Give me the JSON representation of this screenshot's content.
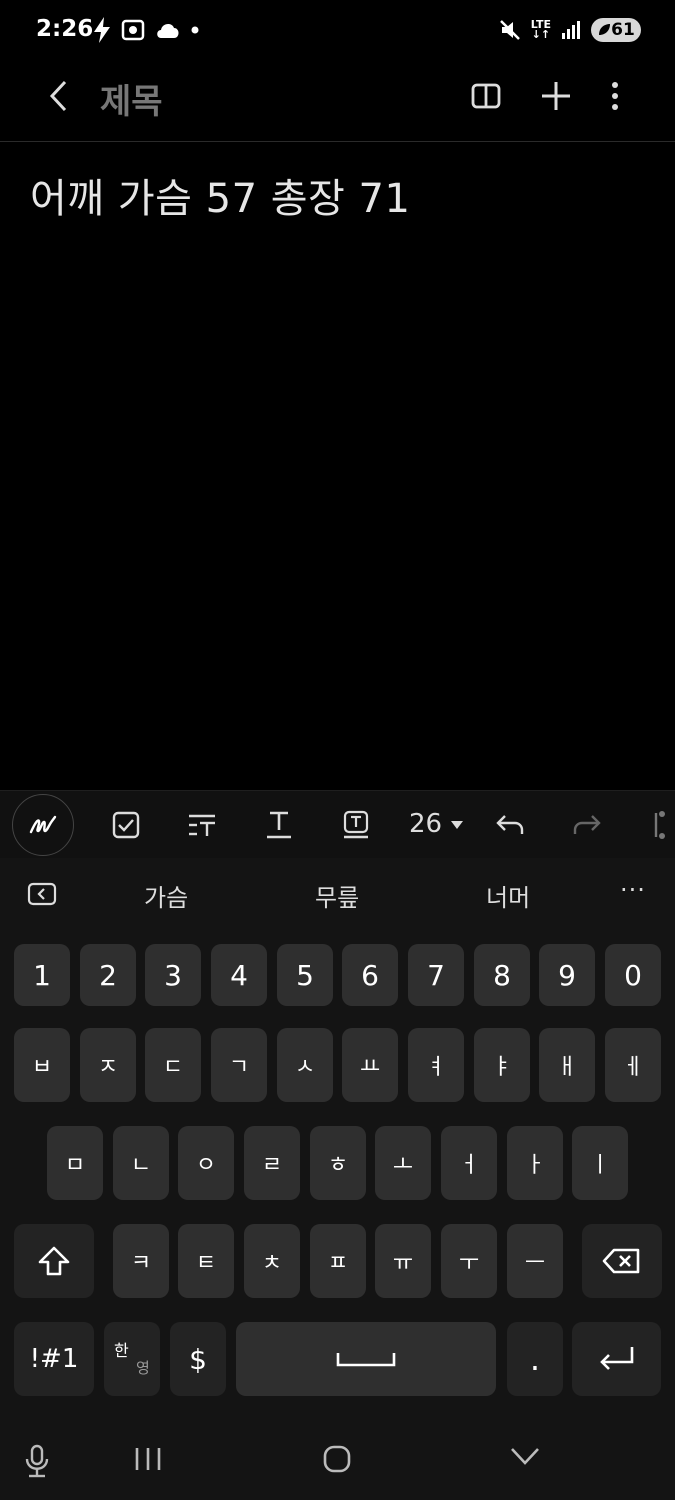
{
  "status_bar": {
    "time": "2:26",
    "network": "LTE",
    "battery": "61",
    "icons": [
      "charging-bolt-icon",
      "screenshot-icon",
      "cloud-icon",
      "dot-icon",
      "mute-icon",
      "signal-icon"
    ]
  },
  "app_bar": {
    "title": "제목",
    "icons": [
      "back-icon",
      "reading-mode-icon",
      "add-icon",
      "more-icon"
    ]
  },
  "note": {
    "text": "어깨  가슴 57 총장 71"
  },
  "format_toolbar": {
    "font_size": "26",
    "icons": [
      "handwriting-icon",
      "checkbox-icon",
      "text-style-icon",
      "underline-text-icon",
      "text-box-icon",
      "dropdown-arrow-icon",
      "undo-icon",
      "redo-icon",
      "text-cursor-icon"
    ]
  },
  "suggestions": {
    "words": [
      "가슴",
      "무릎",
      "너머"
    ],
    "more": "···"
  },
  "keyboard": {
    "row1": [
      "1",
      "2",
      "3",
      "4",
      "5",
      "6",
      "7",
      "8",
      "9",
      "0"
    ],
    "row2": [
      "ㅂ",
      "ㅈ",
      "ㄷ",
      "ㄱ",
      "ㅅ",
      "ㅛ",
      "ㅕ",
      "ㅑ",
      "ㅐ",
      "ㅔ"
    ],
    "row3": [
      "ㅁ",
      "ㄴ",
      "ㅇ",
      "ㄹ",
      "ㅎ",
      "ㅗ",
      "ㅓ",
      "ㅏ",
      "ㅣ"
    ],
    "row4": [
      "ㅋ",
      "ㅌ",
      "ㅊ",
      "ㅍ",
      "ㅠ",
      "ㅜ",
      "ㅡ"
    ],
    "symbols_label": "!#1",
    "lang_top": "한",
    "lang_bottom": "영",
    "currency_label": "$",
    "period_label": "."
  },
  "nav_bar": {
    "icons": [
      "microphone-icon",
      "recent-apps-icon",
      "home-icon",
      "hide-keyboard-icon"
    ]
  }
}
